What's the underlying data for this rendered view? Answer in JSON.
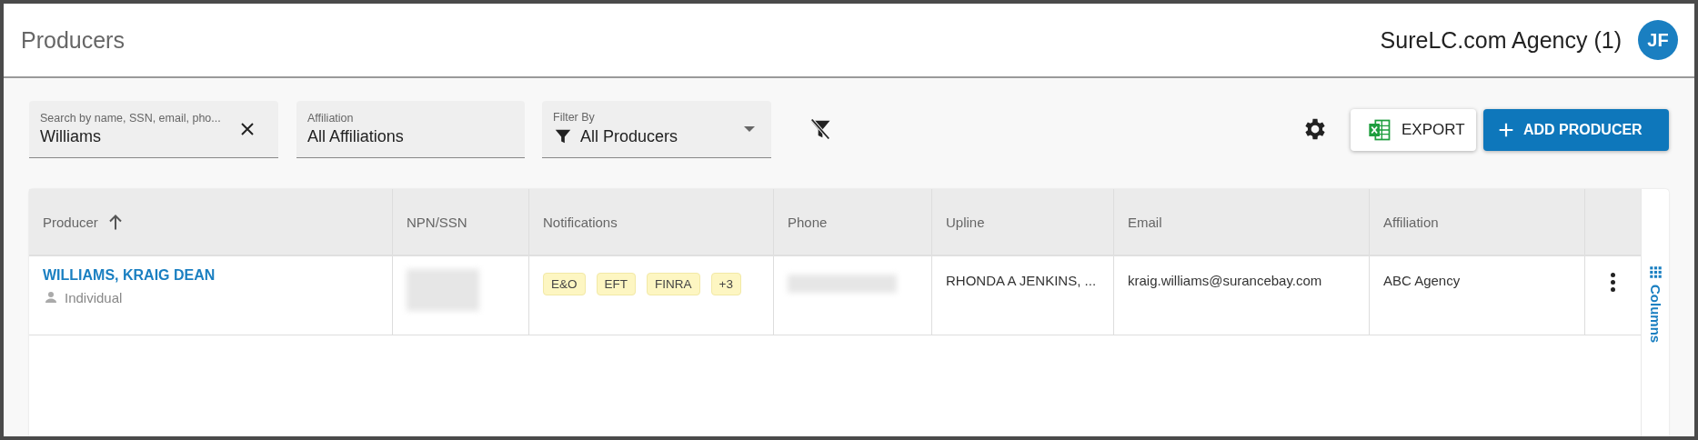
{
  "header": {
    "title": "Producers",
    "agency": "SureLC.com Agency (1)",
    "avatar": "JF"
  },
  "filters": {
    "search": {
      "label": "Search by name, SSN, email, pho...",
      "value": "Williams"
    },
    "affiliation": {
      "label": "Affiliation",
      "value": "All Affiliations"
    },
    "filter_by": {
      "label": "Filter By",
      "value": "All Producers"
    }
  },
  "actions": {
    "export": "EXPORT",
    "add": "ADD PRODUCER"
  },
  "table": {
    "columns": [
      {
        "label": "Producer",
        "sorted": true
      },
      {
        "label": "NPN/SSN",
        "sorted": false
      },
      {
        "label": "Notifications",
        "sorted": false
      },
      {
        "label": "Phone",
        "sorted": false
      },
      {
        "label": "Upline",
        "sorted": false
      },
      {
        "label": "Email",
        "sorted": false
      },
      {
        "label": "Affiliation",
        "sorted": false
      }
    ],
    "rows": [
      {
        "name": "WILLIAMS, KRAIG DEAN",
        "type": "Individual",
        "notifications": [
          "E&O",
          "EFT",
          "FINRA",
          "+3"
        ],
        "upline": "RHONDA A JENKINS, ...",
        "email": "kraig.williams@surancebay.com",
        "affiliation": "ABC Agency"
      }
    ],
    "columns_panel": "Columns"
  }
}
